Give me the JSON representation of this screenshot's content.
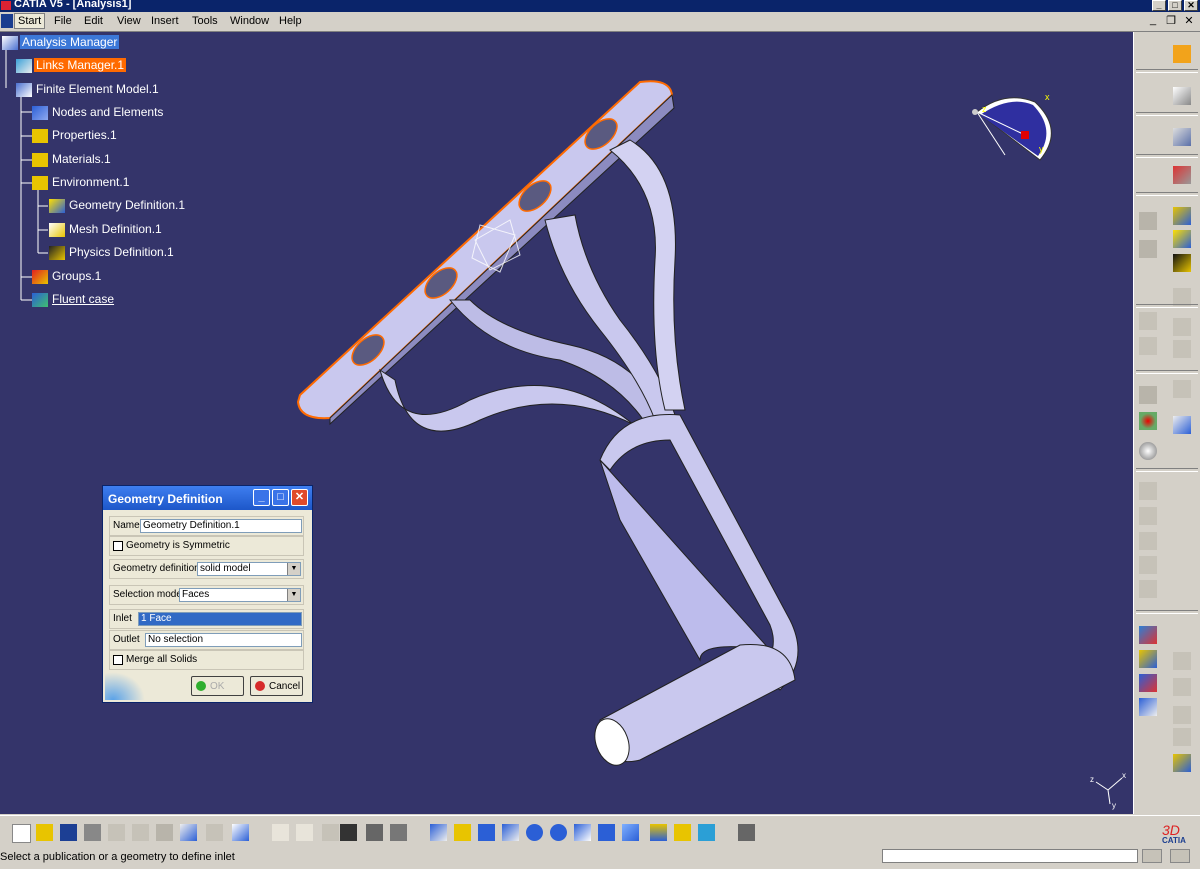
{
  "window": {
    "title": "CATIA V5 - [Analysis1]",
    "min_label": "_",
    "max_label": "□",
    "close_label": "✕"
  },
  "menu": {
    "items": [
      "Start",
      "File",
      "Edit",
      "View",
      "Insert",
      "Tools",
      "Window",
      "Help"
    ]
  },
  "mdi": {
    "min": "_",
    "restore": "❐",
    "close": "✕"
  },
  "tree": {
    "items": [
      {
        "label": "Analysis Manager"
      },
      {
        "label": "Links Manager.1"
      },
      {
        "label": "Finite Element Model.1"
      },
      {
        "label": "Nodes and Elements"
      },
      {
        "label": "Properties.1"
      },
      {
        "label": "Materials.1"
      },
      {
        "label": "Environment.1"
      },
      {
        "label": "Geometry Definition.1"
      },
      {
        "label": "Mesh Definition.1"
      },
      {
        "label": "Physics Definition.1"
      },
      {
        "label": "Groups.1"
      },
      {
        "label": "Fluent case"
      }
    ]
  },
  "compass": {
    "x_label": "x",
    "y_label": "y",
    "z_label": "z"
  },
  "axis_triad": {
    "x_label": "x",
    "y_label": "y",
    "z_label": "z"
  },
  "catia_brand": "CATIA",
  "dialog": {
    "title": "Geometry Definition",
    "name_label": "Name",
    "name_value": "Geometry Definition.1",
    "symmetric_label": "Geometry is Symmetric",
    "geometry_def_label": "Geometry definition",
    "geometry_def_value": "solid model",
    "selection_mode_label": "Selection mode",
    "selection_mode_value": "Faces",
    "inlet_label": "Inlet",
    "inlet_value": "1 Face",
    "outlet_label": "Outlet",
    "outlet_value": "No selection",
    "merge_label": "Merge all Solids",
    "ok_label": "OK",
    "cancel_label": "Cancel"
  },
  "status": {
    "message": "Select a publication or a geometry to define inlet"
  },
  "colors": {
    "viewport": "#34346a",
    "model": "#c9c8ee",
    "highlight": "#ff6a00",
    "title_blue": "#0a246a"
  }
}
